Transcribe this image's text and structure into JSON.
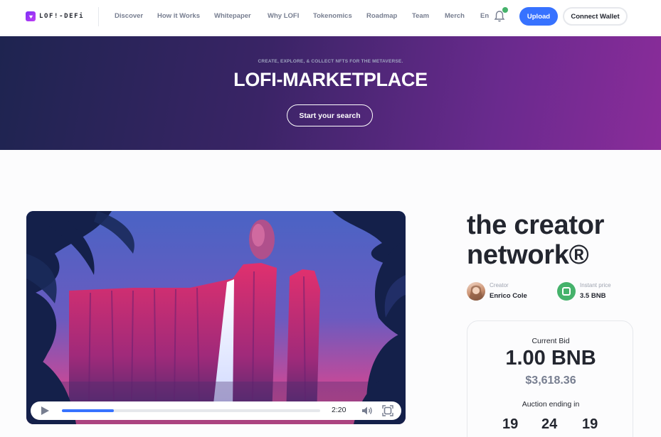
{
  "header": {
    "logo_text": "LOF!-DEFi",
    "nav": [
      "Discover",
      "How it Works",
      "Whitepaper",
      "Why LOFI",
      "Tokenomics",
      "Roadmap",
      "Team",
      "Merch",
      "En"
    ],
    "upload_label": "Upload",
    "connect_label": "Connect Wallet",
    "notification_indicator_color": "#45b26b"
  },
  "hero": {
    "subtitle": "CREATE, EXPLORE, & COLLECT NFTS FOR THE METAVERSE.",
    "title": "LOFI-MARKETPLACE",
    "button_label": "Start your search"
  },
  "player": {
    "time": "2:20",
    "progress": 0.2
  },
  "item": {
    "title": "the creator network®",
    "creator_label": "Creator",
    "creator_name": "Enrico Cole",
    "price_label": "Instant price",
    "price_value": "3.5 BNB"
  },
  "bid": {
    "current_label": "Current Bid",
    "amount": "1.00 BNB",
    "usd": "$3,618.36",
    "auction_label": "Auction ending in",
    "countdown": [
      "19",
      "24",
      "19"
    ]
  },
  "colors": {
    "accent": "#3772ff",
    "success": "#45b26b"
  }
}
